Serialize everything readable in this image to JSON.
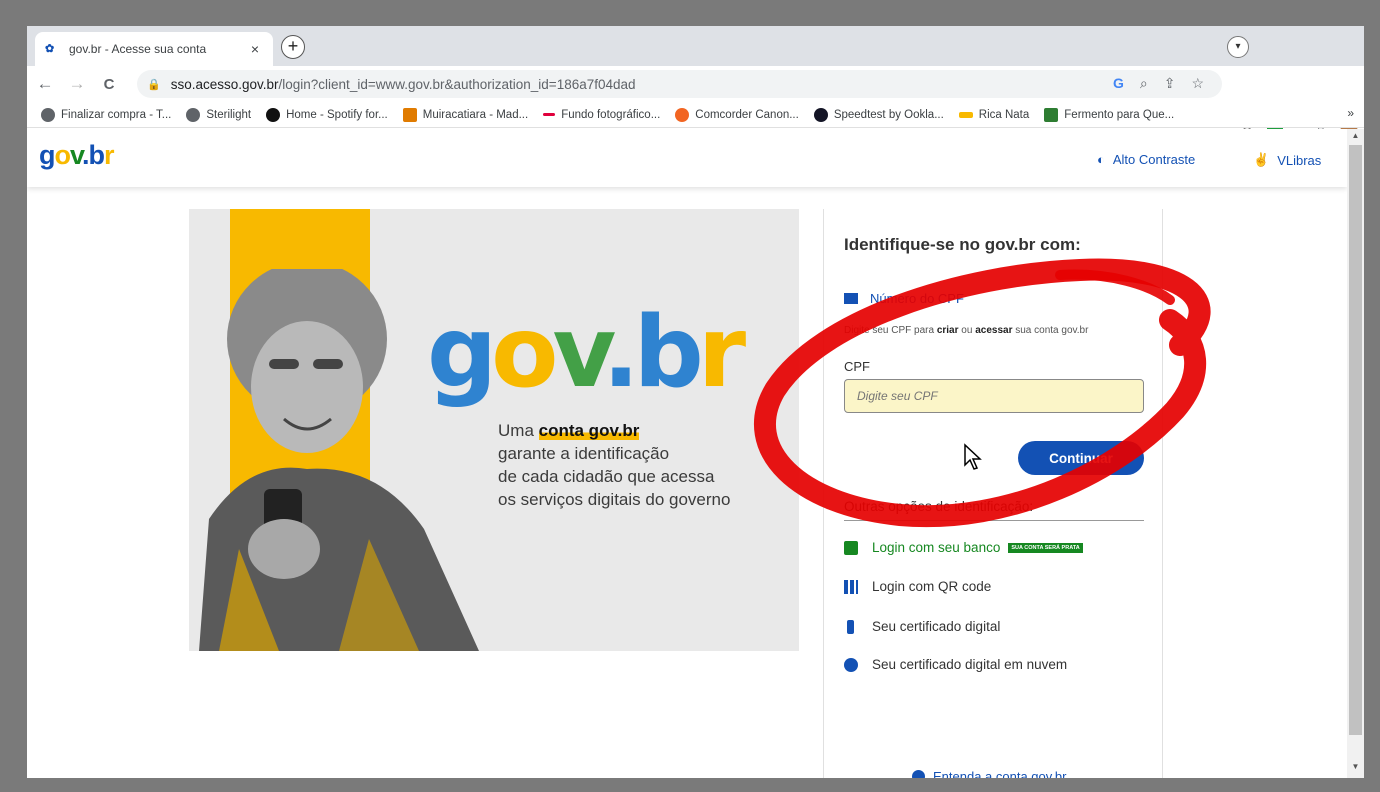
{
  "browser": {
    "tab_title": "gov.br - Acesse sua conta",
    "tab_close": "×",
    "new_tab": "+",
    "url_host": "sso.acesso.gov.br",
    "url_path": "/login?client_id=www.gov.br&authorization_id=186a7f04dad",
    "nav": {
      "back": "←",
      "forward": "→",
      "reload": "C"
    },
    "bookmarks": [
      {
        "label": "Finalizar compra - T...",
        "color": "#5f6368"
      },
      {
        "label": "Sterilight",
        "color": "#5f6368"
      },
      {
        "label": "Home - Spotify for...",
        "color": "#111111"
      },
      {
        "label": "Muiracatiara - Mad...",
        "color": "#e07b00"
      },
      {
        "label": "Fundo fotográfico...",
        "color": "#e0003c"
      },
      {
        "label": "Comcorder Canon...",
        "color": "#f26522"
      },
      {
        "label": "Speedtest by Ookla...",
        "color": "#141526"
      },
      {
        "label": "Rica Nata",
        "color": "#f8b900"
      },
      {
        "label": "Fermento para Que...",
        "color": "#2e7d32"
      }
    ],
    "bookmarks_more": "»"
  },
  "site": {
    "logo": {
      "g": "g",
      "o": "o",
      "v": "v",
      "dot": ".",
      "b": "b",
      "r": "r"
    },
    "header_links": {
      "contrast": "Alto Contraste",
      "vlibras": "VLibras"
    },
    "banner": {
      "tag_pre": "Uma ",
      "tag_bold": "conta gov.br",
      "tag_line2": "garante a identificação",
      "tag_line3": "de cada cidadão que acessa",
      "tag_line4": "os serviços digitais do governo"
    },
    "login": {
      "title": "Identifique-se no gov.br com:",
      "cpf_option": "Número do CPF",
      "hint_pre": "Digite seu CPF para ",
      "hint_create": "criar",
      "hint_mid": " ou ",
      "hint_access": "acessar",
      "hint_post": " sua conta gov.br",
      "cpf_label": "CPF",
      "cpf_placeholder": "Digite seu CPF",
      "continue": "Continuar",
      "other_options": "Outras opções de identificação:",
      "alt_options": [
        {
          "label": "Login com seu banco",
          "badge": "SUA CONTA SERÁ PRATA",
          "color": "#168821"
        },
        {
          "label": "Login com QR code"
        },
        {
          "label": "Seu certificado digital"
        },
        {
          "label": "Seu certificado digital em nuvem"
        }
      ],
      "footer_link": "Entenda a conta gov.br"
    }
  },
  "colors": {
    "brand_blue": "#1351b4",
    "brand_yellow": "#f8b900",
    "brand_green": "#168821",
    "annotation_red": "#e50000"
  }
}
